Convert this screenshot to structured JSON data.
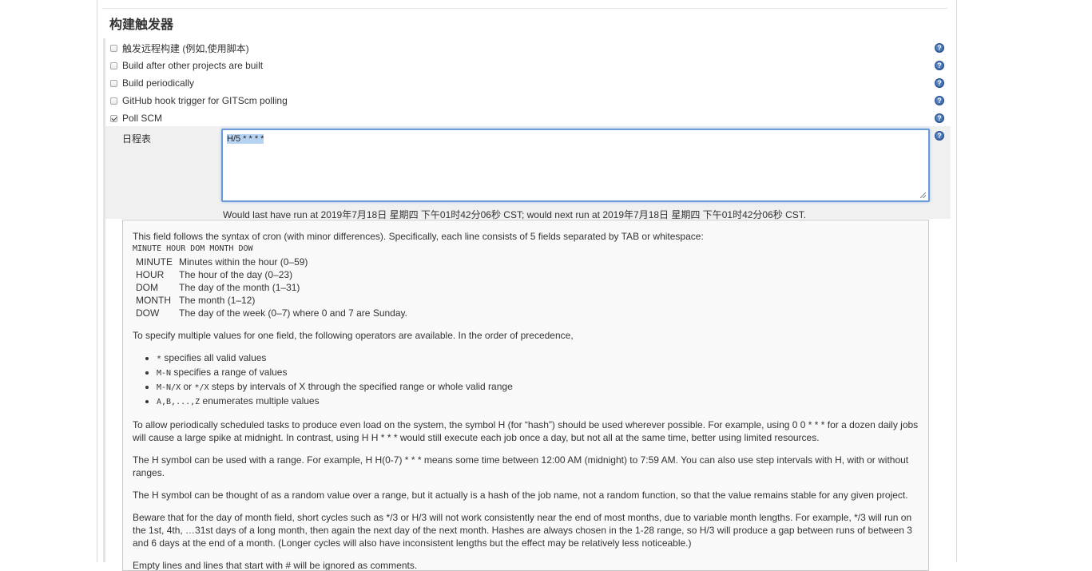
{
  "section": {
    "title": "构建触发器"
  },
  "triggers": [
    {
      "label": "触发远程构建 (例如,使用脚本)",
      "checked": false
    },
    {
      "label": "Build after other projects are built",
      "checked": false
    },
    {
      "label": "Build periodically",
      "checked": false
    },
    {
      "label": "GitHub hook trigger for GITScm polling",
      "checked": false
    },
    {
      "label": "Poll SCM",
      "checked": true
    }
  ],
  "help_icon": "question-mark-icon",
  "schedule": {
    "label": "日程表",
    "value": "H/5 * * * *",
    "status": "Would last have run at 2019年7月18日 星期四 下午01时42分06秒 CST; would next run at 2019年7月18日 星期四 下午01时42分06秒 CST."
  },
  "help": {
    "intro": "This field follows the syntax of cron (with minor differences). Specifically, each line consists of 5 fields separated by TAB or whitespace:",
    "syntax_line": "MINUTE HOUR DOM MONTH DOW",
    "fields": [
      {
        "name": "MINUTE",
        "desc": "Minutes within the hour (0–59)"
      },
      {
        "name": "HOUR",
        "desc": "The hour of the day (0–23)"
      },
      {
        "name": "DOM",
        "desc": "The day of the month (1–31)"
      },
      {
        "name": "MONTH",
        "desc": "The month (1–12)"
      },
      {
        "name": "DOW",
        "desc": "The day of the week (0–7) where 0 and 7 are Sunday."
      }
    ],
    "operators_intro": "To specify multiple values for one field, the following operators are available. In the order of precedence,",
    "operators": [
      {
        "code": "*",
        "text": " specifies all valid values"
      },
      {
        "code": "M-N",
        "text": " specifies a range of values"
      },
      {
        "code": "M-N/X",
        "mid": " or ",
        "code2": "*/X",
        "text": " steps by intervals of X through the specified range or whole valid range"
      },
      {
        "code": "A,B,...,Z",
        "text": " enumerates multiple values"
      }
    ],
    "p_hash_1": "To allow periodically scheduled tasks to produce even load on the system, the symbol H (for “hash”) should be used wherever possible. For example, using 0 0 * * * for a dozen daily jobs will cause a large spike at midnight. In contrast, using H H * * * would still execute each job once a day, but not all at the same time, better using limited resources.",
    "p_hash_2": "The H symbol can be used with a range. For example, H H(0-7) * * * means some time between 12:00 AM (midnight) to 7:59 AM. You can also use step intervals with H, with or without ranges.",
    "p_hash_3": "The H symbol can be thought of as a random value over a range, but it actually is a hash of the job name, not a random function, so that the value remains stable for any given project.",
    "p_beware": "Beware that for the day of month field, short cycles such as */3 or H/3 will not work consistently near the end of most months, due to variable month lengths. For example, */3 will run on the 1st, 4th, …31st days of a long month, then again the next day of the next month. Hashes are always chosen in the 1-28 range, so H/3 will produce a gap between runs of between 3 and 6 days at the end of a month. (Longer cycles will also have inconsistent lengths but the effect may be relatively less noticeable.)",
    "p_empty": "Empty lines and lines that start with # will be ignored as comments."
  }
}
